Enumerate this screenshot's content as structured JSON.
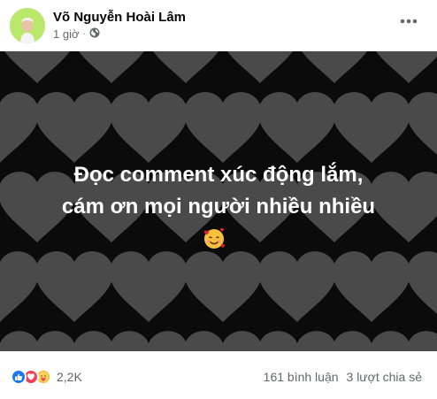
{
  "post": {
    "author": "Võ Nguyễn Hoài Lâm",
    "time": "1 giờ",
    "privacy_icon": "globe-icon",
    "more_icon": "more-horizontal-icon",
    "caption_line1": "Đọc comment xúc động lắm,",
    "caption_line2": "cám ơn mọi người nhiều nhiều",
    "caption_emoji": "smiling-face-with-hearts"
  },
  "footer": {
    "reaction_icons": [
      "like-icon",
      "love-icon",
      "care-icon"
    ],
    "reaction_count": "2,2K",
    "comments": "161 bình luận",
    "shares": "3 lượt chia sẻ"
  },
  "colors": {
    "background": "#0b0b0b",
    "heart": "#4a4a4a",
    "text_secondary": "#65676b",
    "like": "#1877f2",
    "love": "#f33e58",
    "care": "#f7b125"
  }
}
